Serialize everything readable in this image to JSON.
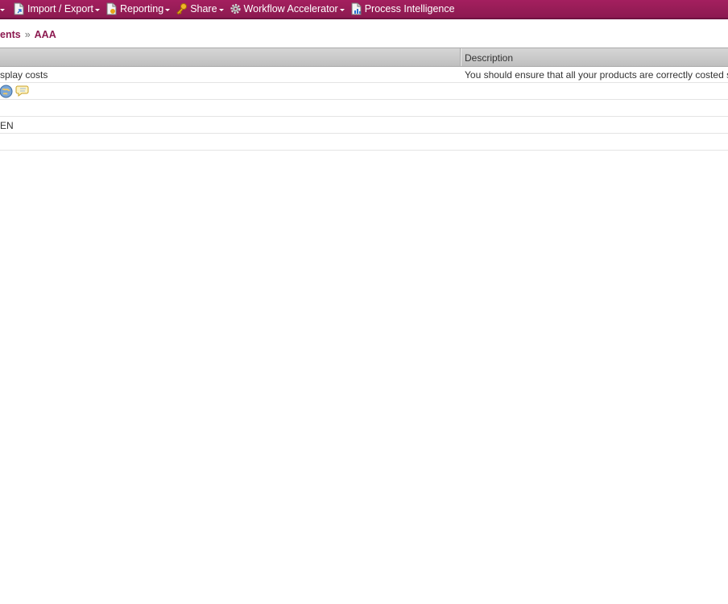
{
  "toolbar": {
    "items": [
      {
        "label": "Import / Export",
        "icon": "document-arrow-icon",
        "has_menu": true
      },
      {
        "label": "Reporting",
        "icon": "report-document-icon",
        "has_menu": true
      },
      {
        "label": "Share",
        "icon": "key-icon",
        "has_menu": true
      },
      {
        "label": "Workflow Accelerator",
        "icon": "gear-icon",
        "has_menu": true
      },
      {
        "label": "Process Intelligence",
        "icon": "chart-document-icon",
        "has_menu": false
      }
    ],
    "colors": {
      "bar": "#a41f5f",
      "text": "#ffffff"
    }
  },
  "breadcrumb": {
    "parent": "ents",
    "separator": "»",
    "current": "AAA"
  },
  "grid": {
    "columns": [
      "",
      "Description"
    ],
    "rows": [
      {
        "c1": "splay costs",
        "c2": "You should ensure that all your products are correctly costed so"
      },
      {
        "c1": "",
        "c2": "",
        "icons": [
          "globe-icon",
          "comment-bubble-icon"
        ]
      },
      {
        "c1": "",
        "c2": ""
      },
      {
        "c1": "EN",
        "c2": ""
      },
      {
        "c1": "",
        "c2": ""
      }
    ]
  }
}
